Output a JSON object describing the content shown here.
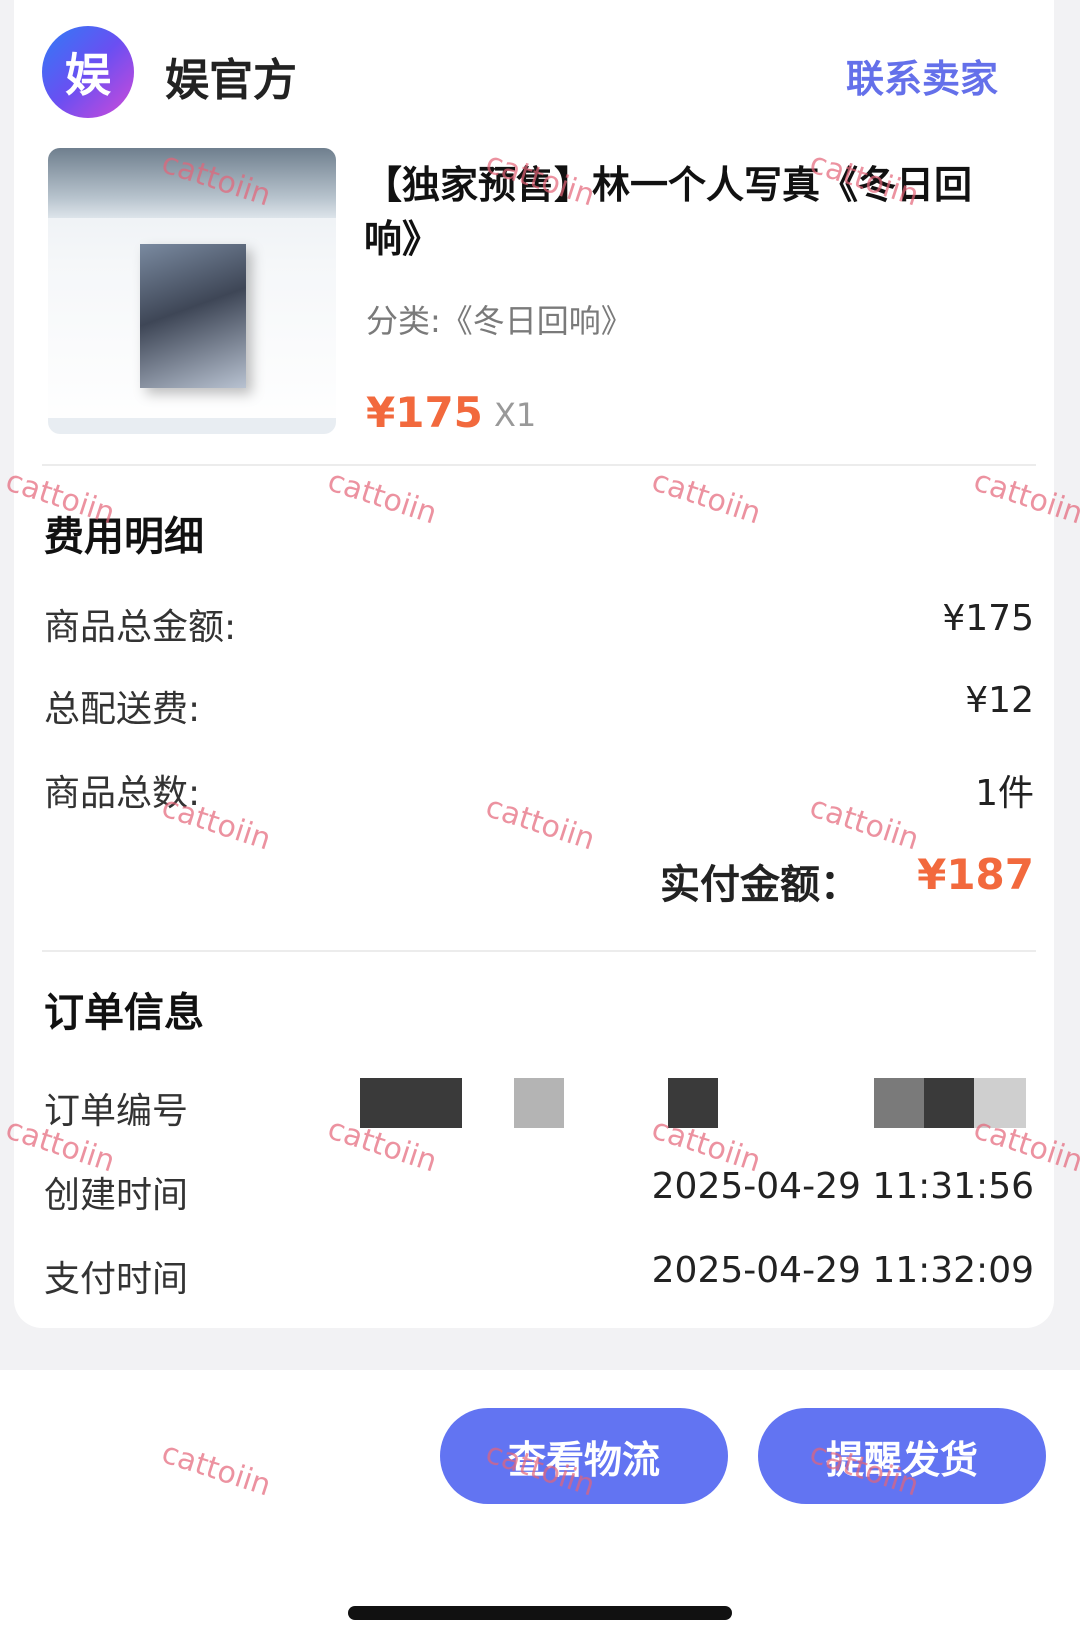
{
  "shop": {
    "logo_glyph": "娱",
    "name": "娱官方",
    "contact_label": "联系卖家"
  },
  "product": {
    "title": "【独家预售】林一个人写真《冬日回响》",
    "category": "分类:《冬日回响》",
    "price": "¥175",
    "quantity": "X1"
  },
  "fees": {
    "section_title": "费用明细",
    "rows": [
      {
        "label": "商品总金额:",
        "value": "¥175"
      },
      {
        "label": "总配送费:",
        "value": "¥12"
      },
      {
        "label": "商品总数:",
        "value": "1件"
      }
    ],
    "total_label": "实付金额：",
    "total_value": "¥187",
    "accent_color": "#f2693d"
  },
  "order": {
    "section_title": "订单信息",
    "rows": [
      {
        "label": "订单编号",
        "value": ""
      },
      {
        "label": "创建时间",
        "value": "2025-04-29 11:31:56"
      },
      {
        "label": "支付时间",
        "value": "2025-04-29 11:32:09"
      }
    ]
  },
  "actions": {
    "logistics_label": "查看物流",
    "remind_label": "提醒发货",
    "button_color": "#6274f2"
  },
  "watermark": "cattoiin"
}
